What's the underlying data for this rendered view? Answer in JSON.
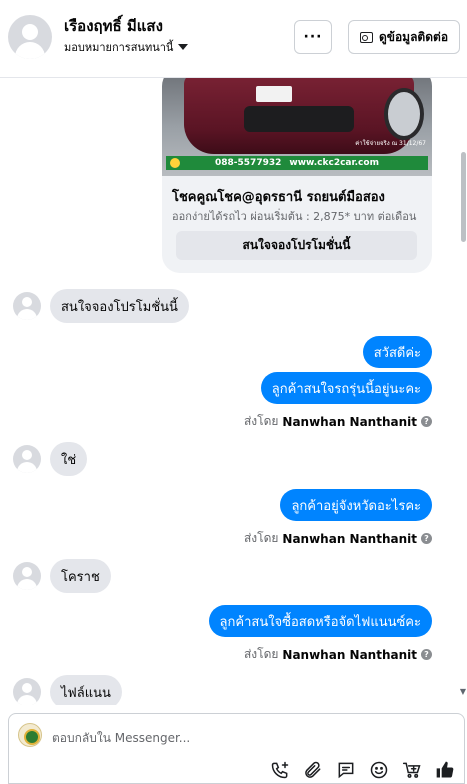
{
  "header": {
    "contact_name": "เรืองฤทธิ์ มีแสง",
    "assign_label": "มอบหมายการสนทนานี้",
    "more_label": "···",
    "contact_info_label": "ดูข้อมูลติดต่อ"
  },
  "ad": {
    "band_phone": "088-5577932",
    "band_site": "www.ckc2car.com",
    "small_text": "ค่าใช้จ่ายจริง ณ 31/12/67",
    "title": "โชคคูณโชค@อุดรธานี รถยนต์มือสอง",
    "subtitle": "ออกง่ายได้รถไว ผ่อนเริ่มต้น : 2,875* บาท ต่อเดือน",
    "cta": "สนใจจองโปรโมชั่นนี้"
  },
  "messages": [
    {
      "dir": "in",
      "text": "สนใจจองโปรโมชั่นนี้"
    },
    {
      "dir": "out",
      "text": "สวัสดีค่ะ"
    },
    {
      "dir": "out",
      "text": "ลูกค้าสนใจรถรุ่นนี้อยู่นะคะ"
    },
    {
      "dir": "in",
      "text": "ใช่"
    },
    {
      "dir": "out",
      "text": "ลูกค้าอยู่จังหวัดอะไรคะ"
    },
    {
      "dir": "in",
      "text": "โคราช"
    },
    {
      "dir": "out",
      "text": "ลูกค้าสนใจซื้อสดหรือจัดไฟแนนซ์คะ"
    },
    {
      "dir": "in",
      "text": "ไฟล์แนน"
    }
  ],
  "sent_by": {
    "prefix": "ส่งโดย",
    "agent": "Nanwhan Nanthanit"
  },
  "composer": {
    "placeholder": "ตอบกลับใน Messenger..."
  },
  "colors": {
    "outgoing_bubble": "#0084ff",
    "incoming_bubble": "#e4e6eb",
    "ad_band": "#1f8a3b"
  },
  "icons": [
    "person-avatar-icon",
    "caret-down-icon",
    "more-icon",
    "contact-card-icon",
    "help-icon",
    "phone-add-icon",
    "attachment-icon",
    "saved-reply-icon",
    "emoji-icon",
    "cart-add-icon",
    "thumbs-up-icon"
  ]
}
